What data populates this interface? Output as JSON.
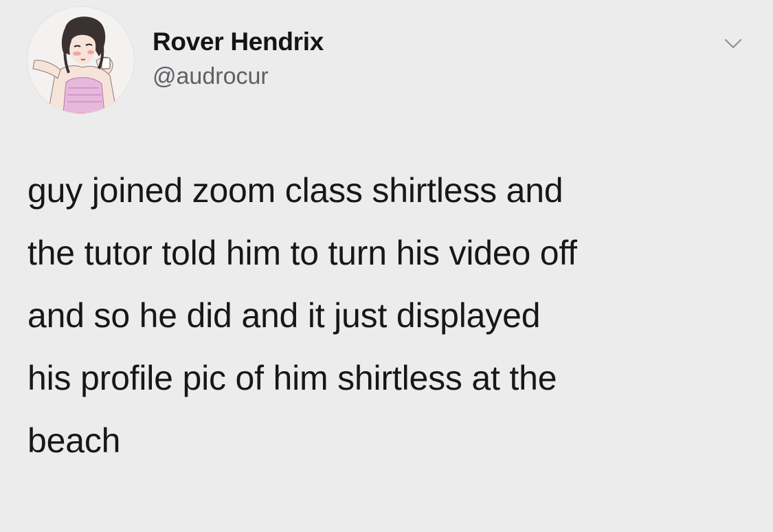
{
  "tweet": {
    "author": {
      "display_name": "Rover Hendrix",
      "handle": "@audrocur",
      "avatar_icon": "anime-girl-avatar-icon"
    },
    "menu_icon": "chevron-down-icon",
    "text_lines": [
      "guy joined zoom class shirtless and",
      "the tutor told him to turn his video off",
      "and so he did and it just displayed",
      "his profile pic of him shirtless at the",
      "beach"
    ]
  },
  "colors": {
    "background": "#ececec",
    "name_text": "#141414",
    "handle_text": "#5d6166",
    "body_text": "#171717"
  }
}
